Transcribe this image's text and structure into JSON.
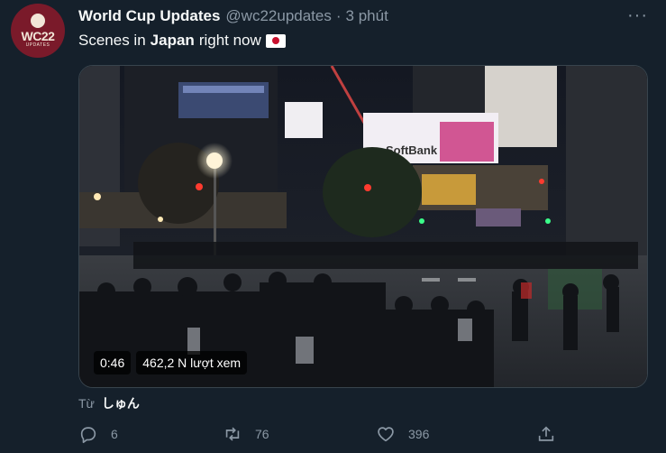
{
  "account": {
    "name": "World Cup Updates",
    "handle": "@wc22updates",
    "time": "3 phút",
    "avatar_text": "WC22",
    "avatar_subtext": "UPDATES"
  },
  "tweet": {
    "text_before": "Scenes in",
    "text_bold": "Japan",
    "text_after": "right now",
    "flag_icon": "japan-flag-icon"
  },
  "video": {
    "duration": "0:46",
    "views": "462,2 N lượt xem",
    "signage_text": "SoftBank"
  },
  "source": {
    "prefix": "Từ",
    "user": "しゅん"
  },
  "actions": {
    "replies": "6",
    "retweets": "76",
    "likes": "396"
  },
  "colors": {
    "background": "#15202b",
    "secondary_text": "#8b98a5",
    "avatar_bg": "#7a1a2a"
  }
}
